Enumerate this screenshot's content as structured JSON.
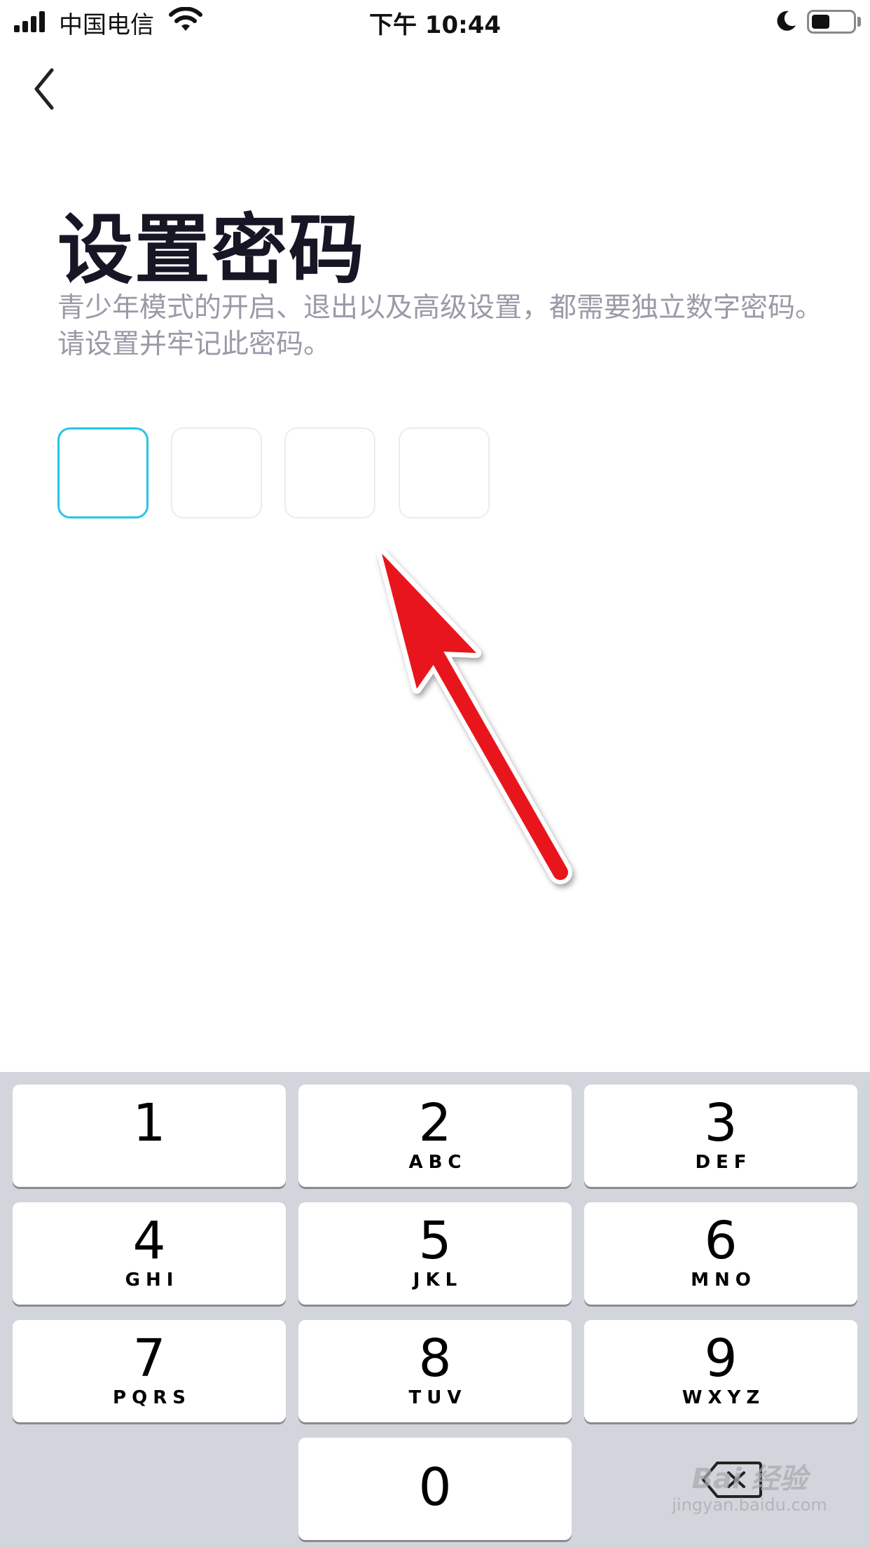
{
  "status_bar": {
    "carrier": "中国电信",
    "time": "下午 10:44",
    "battery_level": 0.45
  },
  "page": {
    "title": "设置密码",
    "subtitle": "青少年模式的开启、退出以及高级设置，都需要独立数字密码。请设置并牢记此密码。"
  },
  "passcode": {
    "length": 4,
    "active_index": 0,
    "active_color": "#27c5e6"
  },
  "keypad": {
    "keys": [
      {
        "digit": "1",
        "letters": ""
      },
      {
        "digit": "2",
        "letters": "ABC"
      },
      {
        "digit": "3",
        "letters": "DEF"
      },
      {
        "digit": "4",
        "letters": "GHI"
      },
      {
        "digit": "5",
        "letters": "JKL"
      },
      {
        "digit": "6",
        "letters": "MNO"
      },
      {
        "digit": "7",
        "letters": "PQRS"
      },
      {
        "digit": "8",
        "letters": "TUV"
      },
      {
        "digit": "9",
        "letters": "WXYZ"
      },
      {
        "digit": "0",
        "letters": ""
      }
    ],
    "background": "#d2d5db"
  },
  "annotation": {
    "arrow_color": "#e8141c"
  },
  "watermark": {
    "brand": "Bai 经验",
    "url": "jingyan.baidu.com"
  }
}
